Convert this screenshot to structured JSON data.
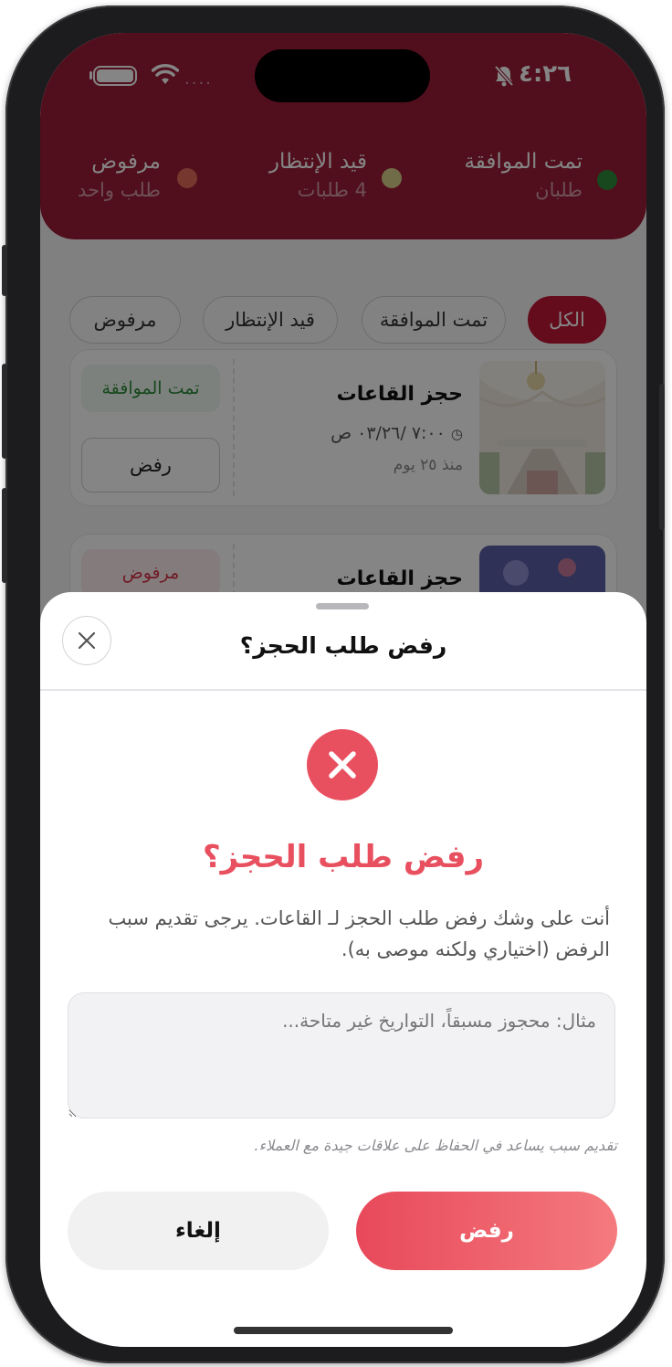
{
  "status_bar": {
    "time": "٤:٢٦",
    "signal_dots": "....",
    "icons": [
      "battery-icon",
      "wifi-icon",
      "bell-muted-icon"
    ]
  },
  "summary": [
    {
      "title": "تمت الموافقة",
      "subtitle": "طلبان",
      "color": "#2e8b3a"
    },
    {
      "title": "قيد الإنتظار",
      "subtitle": "4 طلبات",
      "color": "#d9d08a"
    },
    {
      "title": "مرفوض",
      "subtitle": "طلب واحد",
      "color": "#e26a5a"
    }
  ],
  "filters": [
    {
      "label": "الكل",
      "active": true
    },
    {
      "label": "تمت الموافقة",
      "active": false
    },
    {
      "label": "قيد الإنتظار",
      "active": false
    },
    {
      "label": "مرفوض",
      "active": false
    }
  ],
  "bookings": [
    {
      "title": "حجز القاعات",
      "date": "٧:٠٠ /٠٣/٢٦ ص",
      "ago": "منذ ٢٥ يوم",
      "status": "تمت الموافقة",
      "status_color": "#2e8b3a",
      "status_bg": "#eef7ef",
      "action": "رفض"
    },
    {
      "title": "حجز القاعات",
      "status": "مرفوض",
      "status_color": "#d6344a",
      "status_bg": "#fdeeee"
    }
  ],
  "sheet": {
    "title": "رفض طلب الحجز؟",
    "heading": "رفض طلب الحجز؟",
    "description": "أنت على وشك رفض طلب الحجز لـ القاعات. يرجى تقديم سبب الرفض (اختياري ولكنه موصى به).",
    "reason_placeholder": "مثال: محجوز مسبقاً، التواريخ غير متاحة...",
    "reason_value": "",
    "hint": "تقديم سبب يساعد في الحفاظ على علاقات جيدة مع العملاء.",
    "reject_label": "رفض",
    "cancel_label": "إلغاء",
    "accent": "#e8505f"
  }
}
